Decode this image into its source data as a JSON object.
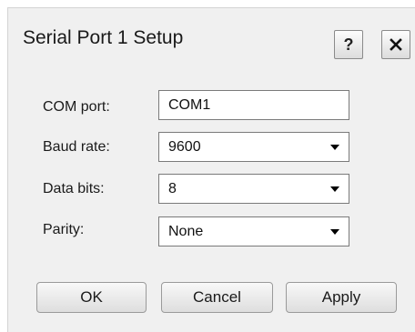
{
  "dialog": {
    "title": "Serial Port 1 Setup",
    "help_label": "?",
    "close_icon": "close-icon"
  },
  "fields": {
    "com_port": {
      "label": "COM port:",
      "value": "COM1"
    },
    "baud_rate": {
      "label": "Baud rate:",
      "value": "9600"
    },
    "data_bits": {
      "label": "Data bits:",
      "value": "8"
    },
    "parity": {
      "label": "Parity:",
      "value": "None"
    }
  },
  "buttons": {
    "ok": "OK",
    "cancel": "Cancel",
    "apply": "Apply"
  }
}
